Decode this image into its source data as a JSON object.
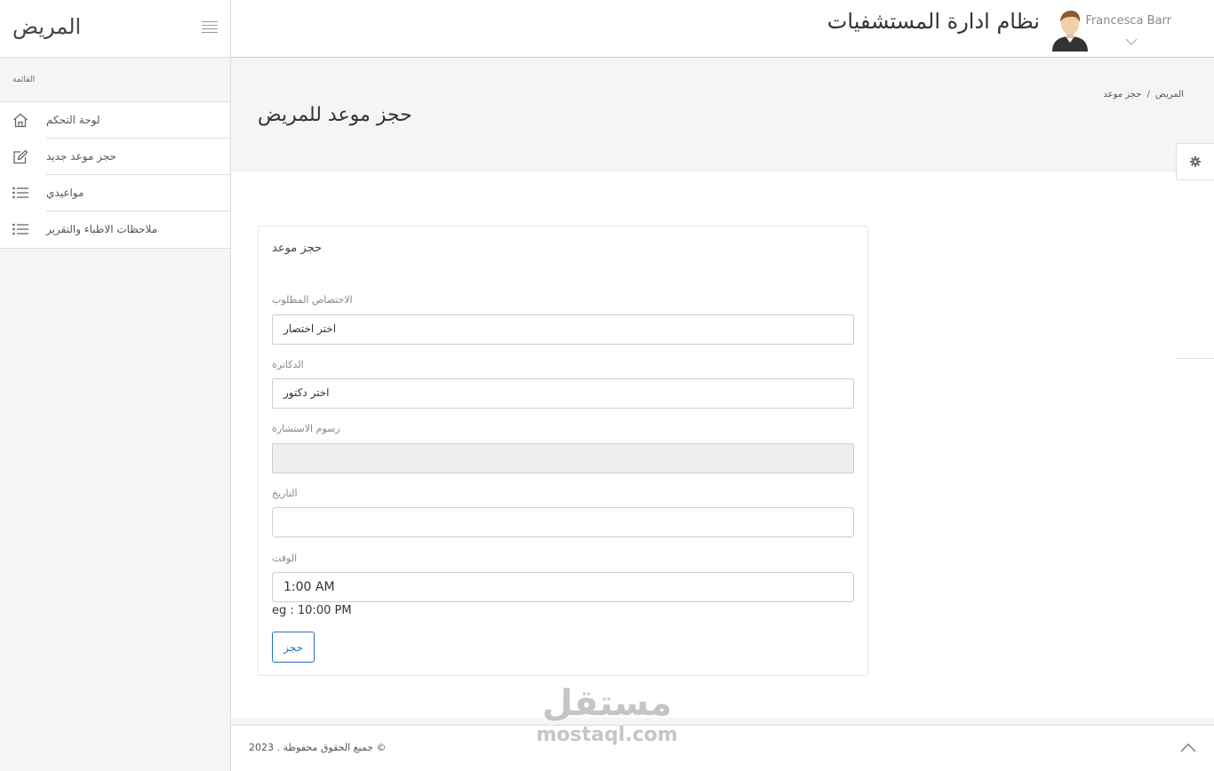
{
  "sidebar": {
    "brand": "المريض",
    "menu_title": "القائمة",
    "items": [
      {
        "label": "لوحة التحكم",
        "icon": "home-icon"
      },
      {
        "label": "حجز موعد جديد",
        "icon": "edit-icon"
      },
      {
        "label": "مواعيدي",
        "icon": "list-icon"
      },
      {
        "label": "ملاحظات الاطباء والتقرير",
        "icon": "list-icon"
      }
    ]
  },
  "header": {
    "app_title": "نظام ادارة المستشفيات",
    "user_name": "Francesca Barr"
  },
  "page": {
    "title": "حجز موعد للمريض",
    "breadcrumb": [
      "المريض",
      "حجز موعد"
    ]
  },
  "form": {
    "card_title": "حجز موعد",
    "specialty_label": "الاختصاص المطلوب",
    "specialty_value": "اختر اختصار",
    "doctors_label": "الدكاترة",
    "doctor_value": "اختر دكتور",
    "fee_label": "رسوم الاستشارة",
    "fee_value": "",
    "date_label": "التاريخ",
    "date_value": "",
    "time_label": "الوقت",
    "time_value": "1:00 AM",
    "time_hint": "eg : 10:00 PM",
    "submit_label": "حجز"
  },
  "footer": {
    "copyright": "جميع الحقوق محفوظة . 2023 ©"
  },
  "watermark": {
    "arabic": "مستقل",
    "latin": "mostaql.com"
  },
  "colors": {
    "accent": "#2b6cc4",
    "sidebar_bg": "#f5f5f5",
    "border": "#dddddd"
  }
}
